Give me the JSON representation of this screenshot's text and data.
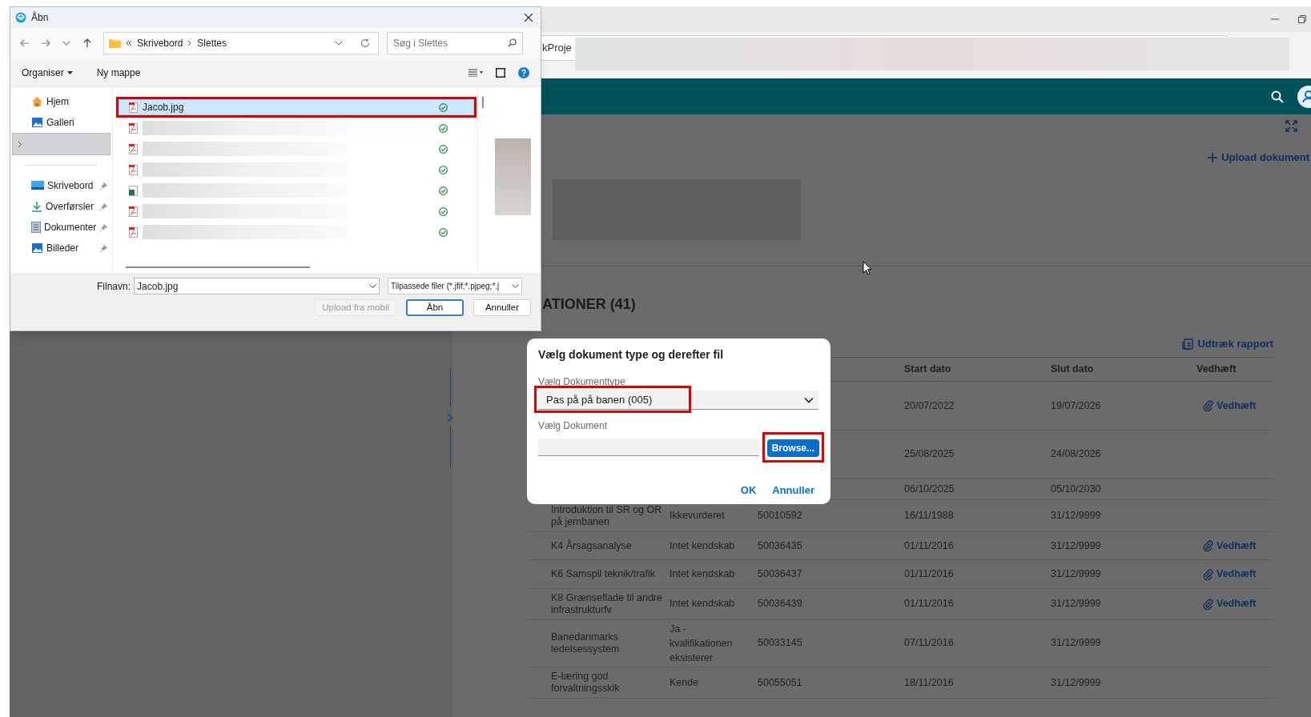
{
  "browser": {
    "address_text": "kProje"
  },
  "page": {
    "upload_label": "Upload dokument",
    "section_title": "ATIONER (41)",
    "report_label": "Udtræk rapport",
    "columns": [
      "Start dato",
      "Slut dato",
      "Vedhæft"
    ],
    "rows": [
      {
        "start": "20/07/2022",
        "end": "19/07/2026",
        "attachment": "Vedhæft"
      },
      {
        "start": "25/08/2025",
        "end": "24/08/2026"
      },
      {
        "start": "06/10/2025",
        "end": "05/10/2030"
      },
      {
        "name": "Introduktion til SR og OR på jernbanen",
        "status": "Ikkevurderet",
        "number": "50010592",
        "start": "16/11/1988",
        "end": "31/12/9999"
      },
      {
        "name": "K4 Årsagsanalyse",
        "status": "Intet kendskab",
        "number": "50036435",
        "start": "01/11/2016",
        "end": "31/12/9999",
        "attachment": "Vedhæft"
      },
      {
        "name": "K6 Samspil teknik/trafik",
        "status": "Intet kendskab",
        "number": "50036437",
        "start": "01/11/2016",
        "end": "31/12/9999",
        "attachment": "Vedhæft"
      },
      {
        "name": "K8 Grænseflade til andre infrastrukturfv",
        "status": "Intet kendskab",
        "number": "50036439",
        "start": "01/11/2016",
        "end": "31/12/9999",
        "attachment": "Vedhæft"
      },
      {
        "name": "Banedanmarks ledelsessystem",
        "status": "Ja - kvalifikationen eksisterer",
        "number": "50033145",
        "start": "07/11/2016",
        "end": "31/12/9999"
      },
      {
        "name": "E-læring god forvaltningsskik",
        "status": "Kende",
        "number": "50055051",
        "start": "18/11/2016",
        "end": "31/12/9999"
      }
    ]
  },
  "upload_modal": {
    "title": "Vælg dokument type og derefter fil",
    "type_label": "Vælg Dokumenttype",
    "type_value": "Pas på på banen (005)",
    "type_highlighted": true,
    "document_label": "Vælg Dokument",
    "browse_label": "Browse...",
    "browse_highlighted": true,
    "buttons": [
      "OK",
      "Annuller"
    ]
  },
  "file_dialog": {
    "title": "Åbn",
    "breadcrumb": [
      "Skrivebord",
      "Slettes"
    ],
    "search_placeholder": "Søg i Slettes",
    "toolbar": [
      "Organiser",
      "Ny mappe"
    ],
    "nav": [
      {
        "kind": "home",
        "label": "Hjem",
        "selected": false
      },
      {
        "kind": "gallery",
        "label": "Galleri",
        "selected": false
      },
      {
        "kind": "redacted",
        "selected": true
      },
      {
        "kind": "desktop",
        "label": "Skrivebord",
        "selected": false
      },
      {
        "kind": "downloads",
        "label": "Overførsler",
        "selected": false
      },
      {
        "kind": "documents",
        "label": "Dokumenter",
        "selected": false
      },
      {
        "kind": "pictures",
        "label": "Billeder",
        "selected": false
      }
    ],
    "files": [
      {
        "kind": "pdf",
        "name": "Jacob.jpg",
        "selected": true,
        "highlighted": true
      },
      {
        "kind": "pdf",
        "selected": false,
        "highlighted": false
      },
      {
        "kind": "pdf",
        "selected": false,
        "highlighted": false
      },
      {
        "kind": "pdf",
        "selected": false,
        "highlighted": false
      },
      {
        "kind": "excel",
        "selected": false,
        "highlighted": false
      },
      {
        "kind": "pdf",
        "selected": false,
        "highlighted": false
      },
      {
        "kind": "pdf",
        "selected": false,
        "highlighted": false
      }
    ],
    "filename_label": "Filnavn:",
    "filename": "Jacob.jpg",
    "filetype": "Tilpassede filer (*.jfif;*.pjpeg;*.j",
    "buttons": [
      {
        "label": "Upload fra mobil",
        "disabled": true,
        "primary": false
      },
      {
        "label": "Åbn",
        "disabled": false,
        "primary": true
      },
      {
        "label": "Annuller",
        "disabled": false,
        "primary": false
      }
    ]
  }
}
